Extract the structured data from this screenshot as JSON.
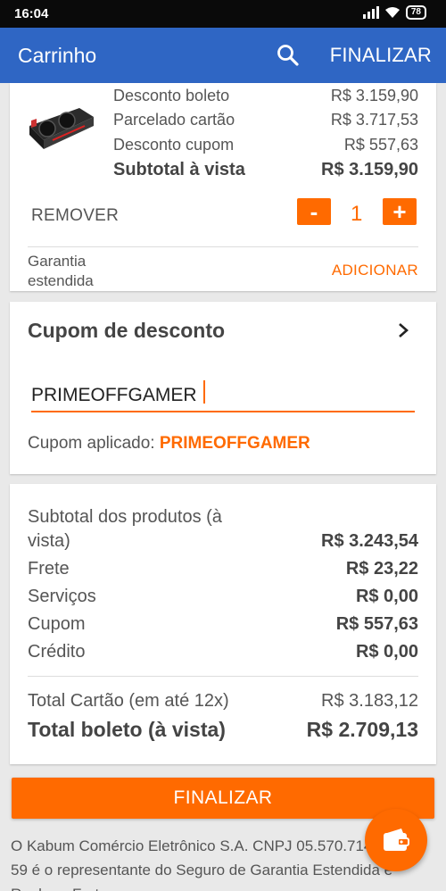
{
  "status_bar": {
    "time": "16:04",
    "battery": "78"
  },
  "app_bar": {
    "title": "Carrinho",
    "finalizar_label": "FINALIZAR"
  },
  "product": {
    "image_icon": "graphics-card-image",
    "prices": [
      {
        "label": "Desconto boleto",
        "value": "R$ 3.159,90"
      },
      {
        "label": "Parcelado cartão",
        "value": "R$ 3.717,53"
      },
      {
        "label": "Desconto cupom",
        "value": "R$ 557,63"
      }
    ],
    "subtotal": {
      "label": "Subtotal à vista",
      "value": "R$ 3.159,90"
    },
    "remover_label": "REMOVER",
    "minus_label": "-",
    "plus_label": "+",
    "quantity": "1",
    "garantia_label": "Garantia estendida",
    "adicionar_label": "ADICIONAR"
  },
  "coupon": {
    "title": "Cupom de desconto",
    "input_value": "PRIMEOFFGAMER",
    "applied_label": "Cupom aplicado:",
    "applied_code": "PRIMEOFFGAMER"
  },
  "summary": {
    "rows": [
      {
        "label": "Subtotal dos produtos (à",
        "label2": "vista)",
        "value": "R$ 3.243,54"
      },
      {
        "label": "Frete",
        "value": "R$ 23,22"
      },
      {
        "label": "Serviços",
        "value": "R$ 0,00"
      },
      {
        "label": "Cupom",
        "value": "R$ 557,63"
      },
      {
        "label": "Crédito",
        "value": "R$ 0,00"
      }
    ],
    "total_cartao": {
      "label": "Total Cartão (em até 12x)",
      "value": "R$ 3.183,12"
    },
    "total_boleto": {
      "label": "Total boleto (à vista)",
      "value": "R$ 2.709,13"
    }
  },
  "finalizar_button": "FINALIZAR",
  "footer_text": "O Kabum Comércio Eletrônico S.A. CNPJ 05.570.714/0001-59 é o representante do Seguro de Garantia Estendida e Roubo e Furto",
  "fab_icon": "wallet-icon",
  "colors": {
    "primary": "#2f66c4",
    "accent": "#ff6a00"
  }
}
